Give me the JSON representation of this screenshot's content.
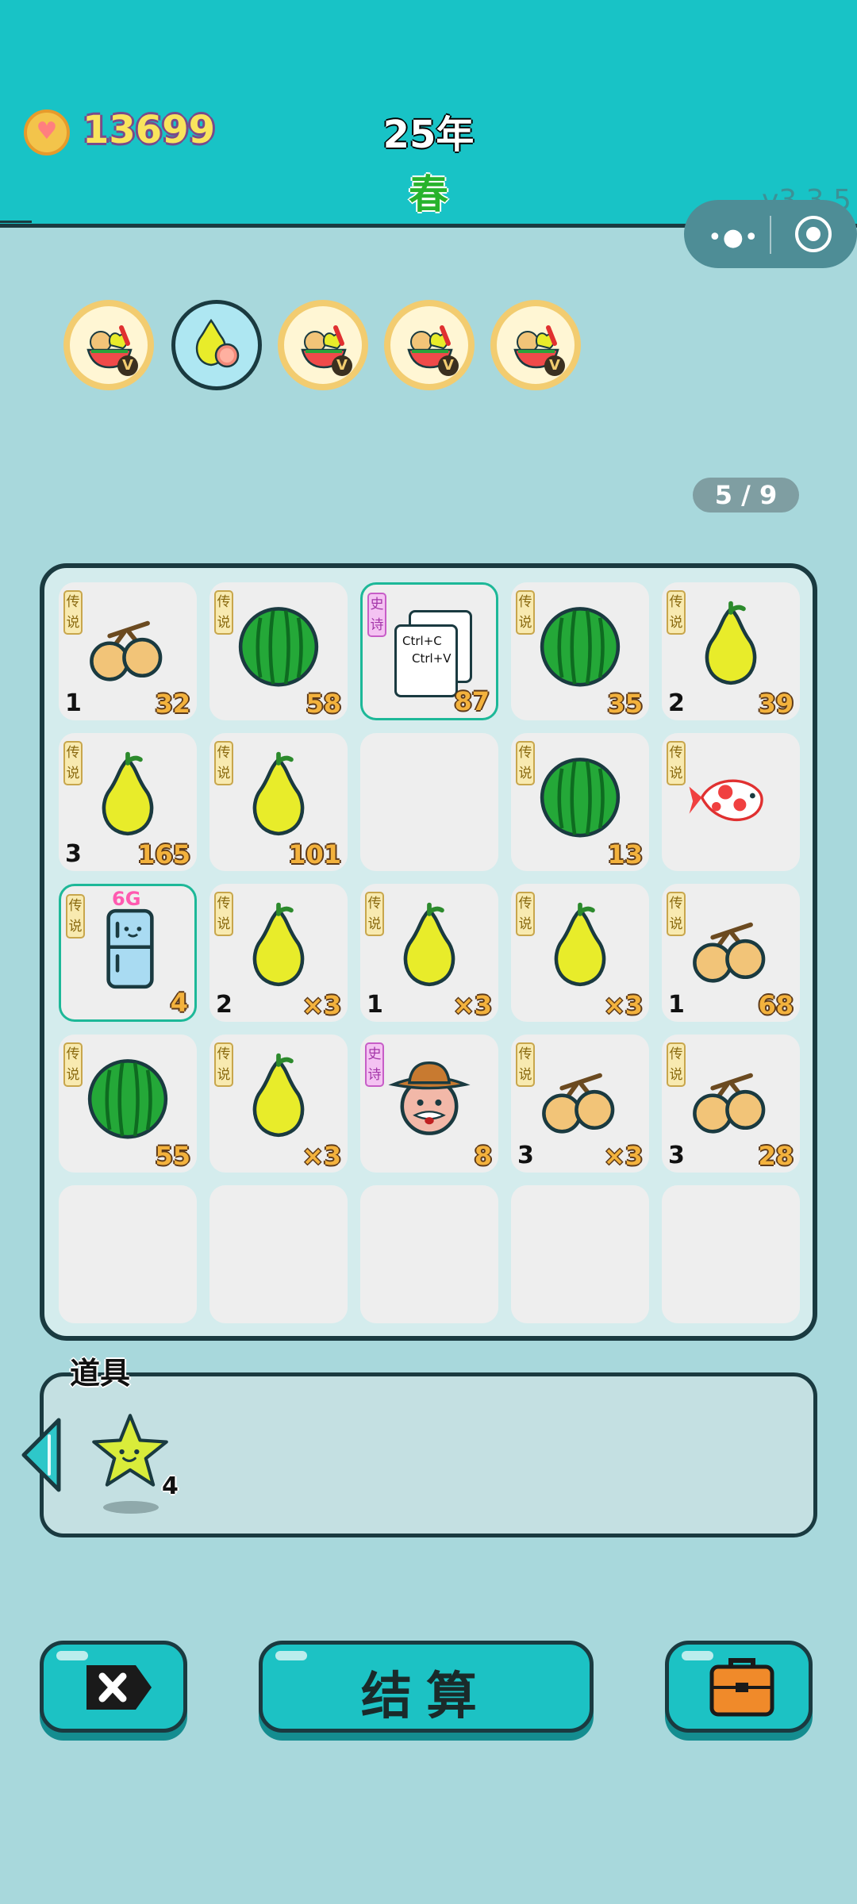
{
  "header": {
    "coins": "13699",
    "year": "25年",
    "season": "春",
    "version": "v3.3.5"
  },
  "rounds": [
    {
      "icon": "fruit-basket-icon",
      "state": "completed"
    },
    {
      "icon": "pomelo-icon",
      "state": "current"
    },
    {
      "icon": "fruit-basket-icon",
      "state": "upcoming"
    },
    {
      "icon": "fruit-basket-icon",
      "state": "upcoming"
    },
    {
      "icon": "fruit-basket-icon",
      "state": "upcoming"
    }
  ],
  "round_badge": "V",
  "pager": "5 / 9",
  "tags": {
    "legend": "传说",
    "epic": "史诗"
  },
  "copy_card": {
    "line1": "Ctrl+C",
    "line2": "Ctrl+V"
  },
  "fridge_badge": "6G",
  "board": [
    [
      {
        "item": "longan",
        "tag": "legend",
        "left": "1",
        "right": "32"
      },
      {
        "item": "watermelon",
        "tag": "legend",
        "left": "",
        "right": "58"
      },
      {
        "item": "copy-card",
        "tag": "epic",
        "left": "",
        "right": "87",
        "highlight": true
      },
      {
        "item": "watermelon",
        "tag": "legend",
        "left": "",
        "right": "35"
      },
      {
        "item": "pomelo",
        "tag": "legend",
        "left": "2",
        "right": "39"
      }
    ],
    [
      {
        "item": "pomelo",
        "tag": "legend",
        "left": "3",
        "right": "165"
      },
      {
        "item": "pomelo",
        "tag": "legend",
        "left": "",
        "right": "101"
      },
      {
        "item": "",
        "tag": "",
        "left": "",
        "right": ""
      },
      {
        "item": "watermelon",
        "tag": "legend",
        "left": "",
        "right": "13"
      },
      {
        "item": "koi",
        "tag": "legend",
        "left": "",
        "right": ""
      }
    ],
    [
      {
        "item": "fridge",
        "tag": "legend",
        "left": "",
        "right": "4",
        "highlight": true
      },
      {
        "item": "pomelo",
        "tag": "legend",
        "left": "2",
        "right": "×3"
      },
      {
        "item": "pomelo",
        "tag": "legend",
        "left": "1",
        "right": "×3"
      },
      {
        "item": "pomelo",
        "tag": "legend",
        "left": "",
        "right": "×3"
      },
      {
        "item": "longan",
        "tag": "legend",
        "left": "1",
        "right": "68"
      }
    ],
    [
      {
        "item": "watermelon",
        "tag": "legend",
        "left": "",
        "right": "55"
      },
      {
        "item": "pomelo",
        "tag": "legend",
        "left": "",
        "right": "×3"
      },
      {
        "item": "farmer",
        "tag": "epic",
        "left": "",
        "right": "8"
      },
      {
        "item": "longan",
        "tag": "legend",
        "left": "3",
        "right": "×3"
      },
      {
        "item": "longan",
        "tag": "legend",
        "left": "3",
        "right": "28"
      }
    ],
    [
      {
        "item": "",
        "tag": "",
        "left": "",
        "right": ""
      },
      {
        "item": "",
        "tag": "",
        "left": "",
        "right": ""
      },
      {
        "item": "",
        "tag": "",
        "left": "",
        "right": ""
      },
      {
        "item": "",
        "tag": "",
        "left": "",
        "right": ""
      },
      {
        "item": "",
        "tag": "",
        "left": "",
        "right": ""
      }
    ]
  ],
  "items_panel": {
    "label": "道具",
    "star_count": "4"
  },
  "buttons": {
    "close_icon": "close-icon",
    "settle": "结算",
    "bag_icon": "briefcase-icon"
  },
  "colors": {
    "teal": "#18c3c6",
    "background": "#a8d8dc",
    "outline": "#1a3a40",
    "gold": "#f3b23d"
  }
}
